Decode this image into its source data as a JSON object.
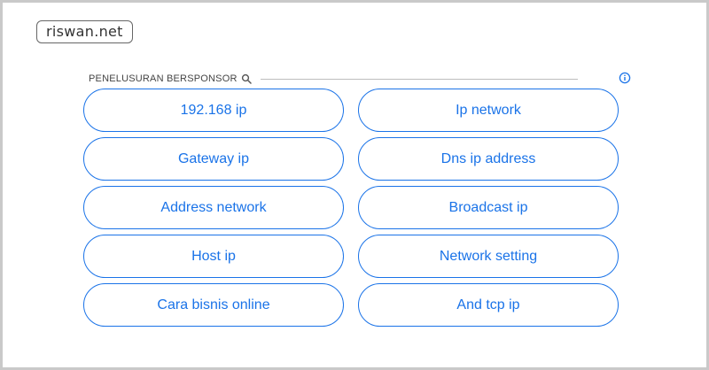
{
  "logo": {
    "text": "riswan.net"
  },
  "ad": {
    "label": "PENELUSURAN BERSPONSOR",
    "search_icon": "magnifier-icon",
    "info_icon": "info-icon",
    "accent": "#1a73e8"
  },
  "links": [
    {
      "label": "192.168 ip"
    },
    {
      "label": "Ip network"
    },
    {
      "label": "Gateway ip"
    },
    {
      "label": "Dns ip address"
    },
    {
      "label": "Address network"
    },
    {
      "label": "Broadcast ip"
    },
    {
      "label": "Host ip"
    },
    {
      "label": "Network setting"
    },
    {
      "label": "Cara bisnis online"
    },
    {
      "label": "And tcp ip"
    }
  ]
}
